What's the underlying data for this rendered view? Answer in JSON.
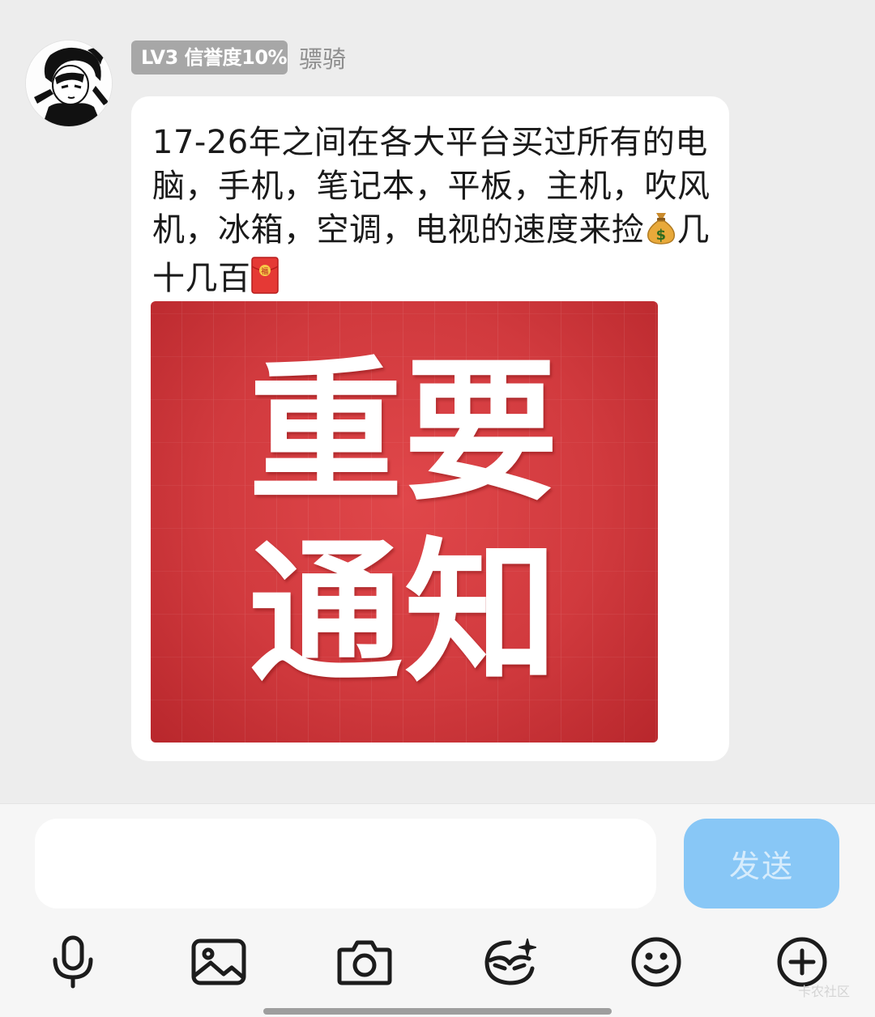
{
  "message": {
    "sender": {
      "level_badge": "LV3 信誉度10%",
      "name": "骠骑"
    },
    "text_before_moneybag": "17-26年之间在各大平台买过所有的电脑，手机，笔记本，平板，主机，吹风机，冰箱，空调，电视的速度来捡",
    "text_after_moneybag": "几十几百",
    "inline_emojis": [
      "money-bag",
      "red-envelope"
    ],
    "image": {
      "line1": "重要",
      "line2": "通知"
    }
  },
  "composer": {
    "input_value": "",
    "send_label": "发送",
    "send_color": "#88c7f6"
  },
  "toolbar": {
    "icons": [
      "microphone-icon",
      "image-icon",
      "camera-icon",
      "sticker-icon",
      "emoji-icon",
      "plus-icon"
    ]
  },
  "watermark": "卡农社区"
}
